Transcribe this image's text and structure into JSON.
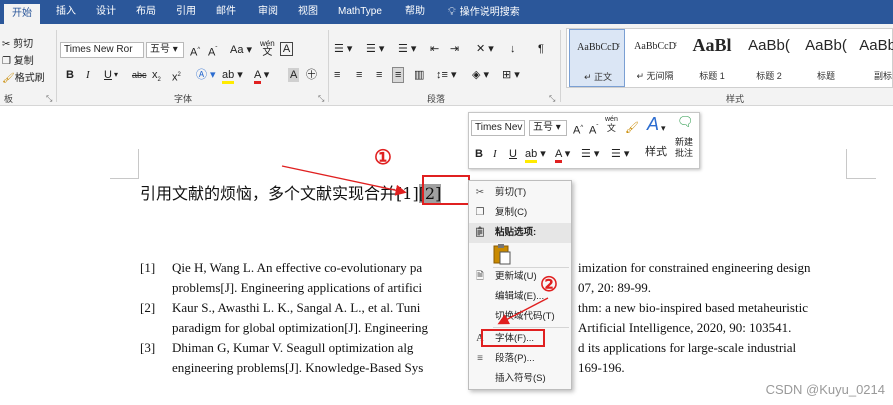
{
  "ribbon": {
    "tabs": [
      "开始",
      "插入",
      "设计",
      "布局",
      "引用",
      "邮件",
      "审阅",
      "视图",
      "MathType",
      "帮助"
    ],
    "tell_me": "操作说明搜索",
    "clipboard": {
      "cut": "剪切",
      "copy": "复制",
      "format_painter": "格式刷",
      "group": "板"
    },
    "font": {
      "name": "Times New Ror",
      "size": "五号",
      "group": "字体",
      "change_case": "Aa",
      "phonetic": "wén",
      "phonetic_base": "文"
    },
    "paragraph": {
      "group": "段落"
    },
    "styles": {
      "group": "样式",
      "items": [
        {
          "sample": "AaBbCcDͨ",
          "name": "↵ 正文"
        },
        {
          "sample": "AaBbCcDͨ",
          "name": "↵ 无间隔"
        },
        {
          "sample": "AaBl",
          "name": "标题 1"
        },
        {
          "sample": "AaBb(",
          "name": "标题 2"
        },
        {
          "sample": "AaBb(",
          "name": "标题"
        },
        {
          "sample": "AaBbC",
          "name": "副标"
        }
      ]
    }
  },
  "document": {
    "body_prefix": "引用文献的烦恼，多个文献实现合并",
    "ref1": "[1]",
    "ref2": "[2]",
    "references": [
      {
        "num": "[1]",
        "line1": "Qie H, Wang L. An effective co-evolutionary pa",
        "line1b": "imization for constrained engineering design",
        "line2": "problems[J]. Engineering applications of artifici",
        "line2b": "07, 20: 89-99."
      },
      {
        "num": "[2]",
        "line1": "Kaur S., Awasthi L. K., Sangal A. L., et al. Tuni",
        "line1b": "thm: a new bio-inspired based metaheuristic",
        "line2": "paradigm for global optimization[J]. Engineering",
        "line2b": "Artificial Intelligence, 2020, 90: 103541."
      },
      {
        "num": "[3]",
        "line1": "Dhiman G, Kumar V. Seagull optimization alg",
        "line1b": "d its applications for large-scale industrial",
        "line2": "engineering problems[J]. Knowledge-Based Sys",
        "line2b": "169-196."
      }
    ]
  },
  "mini_toolbar": {
    "font": "Times Nev",
    "size": "五号",
    "styles": "样式",
    "new_comment": "新建\n批注",
    "phonetic": "wén"
  },
  "context_menu": {
    "items": [
      {
        "label": "剪切(T)",
        "icon": "scissors-icon"
      },
      {
        "label": "复制(C)",
        "icon": "copy-icon"
      },
      {
        "label": "粘贴选项:",
        "icon": "paste-icon"
      },
      {
        "label": "更新域(U)",
        "icon": "update-field-icon"
      },
      {
        "label": "编辑域(E)...",
        "icon": ""
      },
      {
        "label": "切换域代码(T)",
        "icon": ""
      },
      {
        "label": "字体(F)...",
        "icon": "font-icon"
      },
      {
        "label": "段落(P)...",
        "icon": "paragraph-icon"
      },
      {
        "label": "插入符号(S)",
        "icon": ""
      }
    ]
  },
  "annotations": {
    "step1": "①",
    "step2": "②",
    "accent_color": "#e02020"
  },
  "watermark": "CSDN @Kuyu_0214",
  "colors": {
    "ribbon_blue": "#2b579a",
    "ribbon_bg": "#f3f3f3"
  }
}
